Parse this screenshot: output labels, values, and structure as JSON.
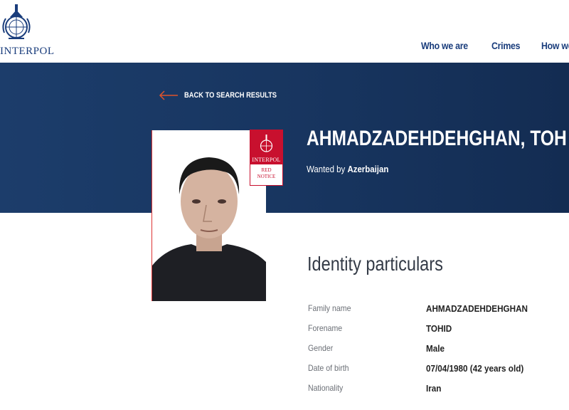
{
  "header": {
    "brand": "INTERPOL",
    "nav": [
      "Who we are",
      "Crimes",
      "How we wor"
    ]
  },
  "back_link": {
    "label": "BACK TO SEARCH RESULTS"
  },
  "notice": {
    "name": "AHMADZADEHDEHGHAN, TOH",
    "wanted_prefix": "Wanted by",
    "wanted_country": "Azerbaijan",
    "badge_brand": "INTERPOL",
    "badge_line1": "RED",
    "badge_line2": "NOTICE"
  },
  "identity": {
    "title": "Identity particulars",
    "rows": [
      {
        "label": "Family name",
        "value": "AHMADZADEHDEHGHAN"
      },
      {
        "label": "Forename",
        "value": "TOHID"
      },
      {
        "label": "Gender",
        "value": "Male"
      },
      {
        "label": "Date of birth",
        "value": "07/04/1980 (42 years old)"
      },
      {
        "label": "Nationality",
        "value": "Iran"
      }
    ]
  },
  "colors": {
    "brand_blue": "#1a3d7c",
    "banner": "#17345e",
    "red_notice": "#c8102e",
    "back_arrow": "#e0532a"
  }
}
